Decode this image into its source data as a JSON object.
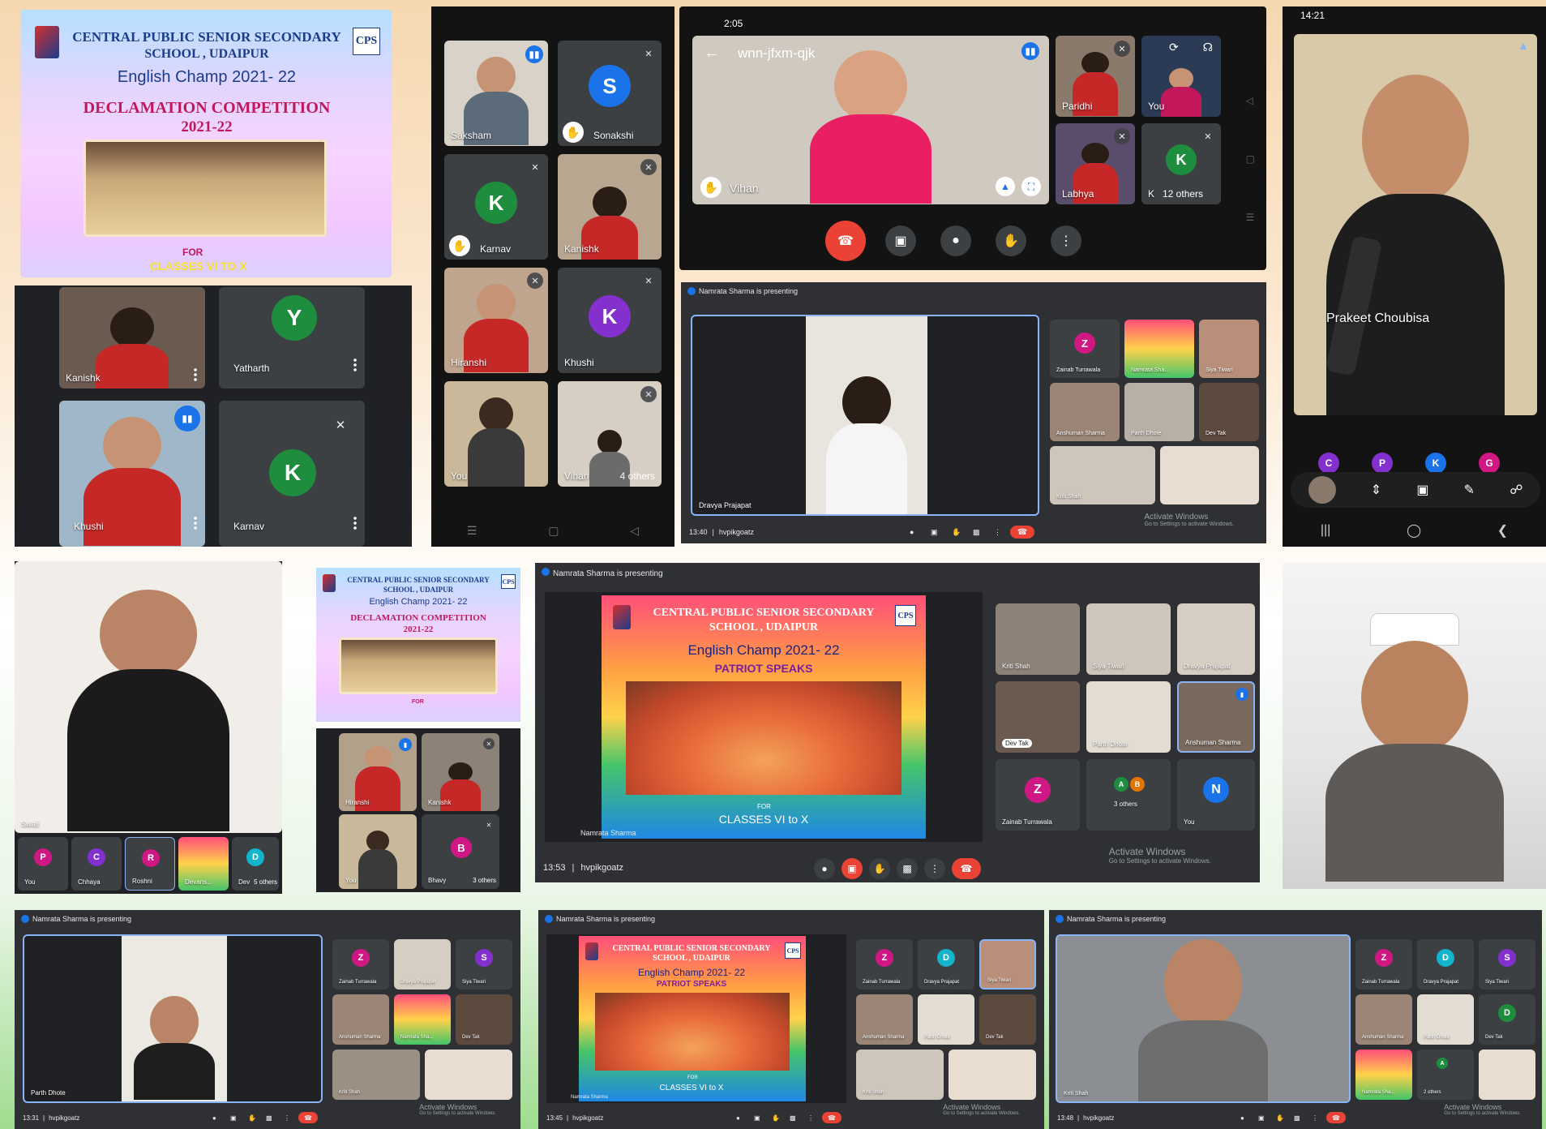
{
  "colors": {
    "meet_dark": "#202124",
    "meet_tile": "#3c4043",
    "accent_blue": "#1a73e8",
    "end_red": "#ea4335",
    "avatar_green": "#1e8e3e",
    "avatar_purple": "#8430ce",
    "avatar_pink": "#d01884",
    "avatar_blue": "#1a73e8",
    "avatar_teal": "#12b5cb"
  },
  "poster1": {
    "school_line1": "CENTRAL PUBLIC SENIOR SECONDARY",
    "school_line2": "SCHOOL , UDAIPUR",
    "logo": "CPS",
    "champ": "English Champ 2021- 22",
    "decl1": "DECLAMATION COMPETITION",
    "decl2": "2021-22",
    "for": "FOR",
    "classes": "CLASSES VI TO X"
  },
  "grid_a": {
    "tiles": [
      {
        "name": "Kanishk"
      },
      {
        "name": "Yatharth",
        "initial": "Y"
      },
      {
        "name": "Khushi"
      },
      {
        "name": "Karnav",
        "initial": "K"
      }
    ]
  },
  "phone_grid": {
    "tiles": [
      {
        "name": "Saksham"
      },
      {
        "name": "Sonakshi",
        "initial": "S"
      },
      {
        "name": "Karnav",
        "initial": "K"
      },
      {
        "name": "Kanishk"
      },
      {
        "name": "Hiranshi"
      },
      {
        "name": "Khushi",
        "initial": "K"
      },
      {
        "name": "You"
      },
      {
        "name": "Vihan"
      }
    ],
    "others": "4 others"
  },
  "phone_land": {
    "time": "2:05",
    "code": "wnn-jfxm-qjk",
    "main_name": "Vihan",
    "tiles": [
      {
        "name": "Paridhi"
      },
      {
        "name": "You"
      },
      {
        "name": "Labhya"
      },
      {
        "name": "K",
        "initial": "K"
      }
    ],
    "others": "12 others"
  },
  "present1": {
    "banner": "Namrata Sharma is presenting",
    "main_name": "Dravya Prajapat",
    "time": "13:40",
    "code": "hvpikgoatz",
    "tiles": [
      {
        "name": "Zainab Turrawala",
        "initial": "Z"
      },
      {
        "name": "Namrata Sha..."
      },
      {
        "name": "Siya Tiwari"
      },
      {
        "name": "Anshuman Sharma"
      },
      {
        "name": "Parth Dhote"
      },
      {
        "name": "Dev Tak"
      },
      {
        "name": "Kriti Shah"
      },
      {
        "name": ""
      }
    ],
    "activate1": "Activate Windows",
    "activate2": "Go to Settings to activate Windows."
  },
  "phone_right": {
    "time": "14:21",
    "name": "Prakeet Choubisa",
    "row": [
      {
        "initial": "C"
      },
      {
        "initial": "P"
      },
      {
        "initial": "K"
      },
      {
        "initial": "G"
      }
    ]
  },
  "grid_b": {
    "main_name": "Swati",
    "row": [
      {
        "name": "You",
        "initial": "P"
      },
      {
        "name": "Chhaya",
        "initial": "C"
      },
      {
        "name": "Roshni",
        "initial": "R"
      },
      {
        "name": "Devans..."
      },
      {
        "name": "Dev",
        "initial": "D"
      }
    ],
    "others": "5 others"
  },
  "poster_small": {
    "school_line1": "CENTRAL PUBLIC SENIOR SECONDARY",
    "school_line2": "SCHOOL , UDAIPUR",
    "logo": "CPS",
    "champ": "English Champ 2021- 22",
    "decl1": "DECLAMATION COMPETITION",
    "decl2": "2021-22",
    "for": "FOR",
    "tiles": [
      {
        "name": "Hiranshi"
      },
      {
        "name": "Kanishk"
      },
      {
        "name": "You"
      },
      {
        "name": "Bhavy",
        "initial": "B"
      }
    ],
    "others": "3 others"
  },
  "present2": {
    "banner": "Namrata Sharma is presenting",
    "slide": {
      "school_line1": "CENTRAL PUBLIC SENIOR SECONDARY",
      "school_line2": "SCHOOL , UDAIPUR",
      "logo": "CPS",
      "champ": "English Champ 2021- 22",
      "ps": "PATRIOT SPEAKS",
      "for": "FOR",
      "classes": "CLASSES VI to X"
    },
    "presenter": "Namrata Sharma",
    "time": "13:53",
    "code": "hvpikgoatz",
    "tiles": [
      {
        "name": "Kriti Shah"
      },
      {
        "name": "Siya Tiwari"
      },
      {
        "name": "Dravya Prajapat"
      },
      {
        "name": "Dev Tak"
      },
      {
        "name": "Parth Dhote"
      },
      {
        "name": "Anshuman Sharma"
      },
      {
        "name": "Zainab Turrawala",
        "initial": "Z"
      },
      {
        "name": "3 others",
        "initial": "A"
      },
      {
        "name": "You",
        "initial": "N"
      }
    ],
    "activate1": "Activate Windows",
    "activate2": "Go to Settings to activate Windows."
  },
  "present3": {
    "banner": "Namrata Sharma is presenting",
    "main_name": "Parth Dhote",
    "time": "13:31",
    "code": "hvpikgoatz",
    "tiles": [
      {
        "name": "Zainab Turrawala",
        "initial": "Z"
      },
      {
        "name": "Dravya Prajapat"
      },
      {
        "name": "Siya Tiwari",
        "initial": "S"
      },
      {
        "name": "Anshuman Sharma"
      },
      {
        "name": "Namrata Sha..."
      },
      {
        "name": "Dev Tak"
      },
      {
        "name": "Kriti Shah"
      },
      {
        "name": ""
      }
    ],
    "activate1": "Activate Windows",
    "activate2": "Go to Settings to activate Windows."
  },
  "present4": {
    "banner": "Namrata Sharma is presenting",
    "slide": {
      "school_line1": "CENTRAL PUBLIC SENIOR SECONDARY",
      "school_line2": "SCHOOL , UDAIPUR",
      "logo": "CPS",
      "champ": "English Champ 2021- 22",
      "ps": "PATRIOT SPEAKS",
      "for": "FOR",
      "classes": "CLASSES VI to X"
    },
    "presenter": "Namrata Sharma",
    "time": "13:45",
    "code": "hvpikgoatz",
    "tiles": [
      {
        "name": "Zainab Turrawala",
        "initial": "Z"
      },
      {
        "name": "Dravya Prajapat",
        "initial": "D"
      },
      {
        "name": "Siya Tiwari"
      },
      {
        "name": "Anshuman Sharma"
      },
      {
        "name": "Parth Dhote"
      },
      {
        "name": "Dev Tak"
      },
      {
        "name": "Kriti Shah"
      },
      {
        "name": ""
      }
    ],
    "activate1": "Activate Windows",
    "activate2": "Go to Settings to activate Windows."
  },
  "present5": {
    "banner": "Namrata Sharma is presenting",
    "main_name": "Kriti Shah",
    "time": "13:48",
    "code": "hvpikgoatz",
    "tiles": [
      {
        "name": "Zainab Turrawala",
        "initial": "Z"
      },
      {
        "name": "Dravya Prajapat",
        "initial": "D"
      },
      {
        "name": "Siya Tiwari",
        "initial": "S"
      },
      {
        "name": "Anshuman Sharma"
      },
      {
        "name": "Parth Dhote"
      },
      {
        "name": "Dev Tak",
        "initial": "D"
      },
      {
        "name": "Namrata Sha..."
      },
      {
        "name": "2 others",
        "initial": "A"
      },
      {
        "name": ""
      }
    ],
    "activate1": "Activate Windows",
    "activate2": "Go to Settings to activate Windows."
  }
}
